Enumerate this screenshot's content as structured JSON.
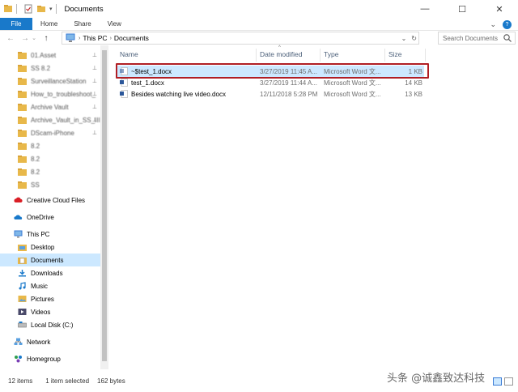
{
  "window": {
    "title": "Documents",
    "minimize": "—",
    "maximize": "☐",
    "close": "✕"
  },
  "ribbon": {
    "tabs": [
      "File",
      "Home",
      "Share",
      "View"
    ],
    "expand": "⌄",
    "help": "?"
  },
  "address": {
    "back": "←",
    "forward": "→",
    "recent": "⌄",
    "up": "↑",
    "segments": [
      "This PC",
      "Documents"
    ],
    "sep": "›",
    "dropdown": "⌄",
    "refresh": "↻",
    "search_placeholder": "Search Documents"
  },
  "nav": {
    "quick_access": [
      {
        "label": "01.Asset",
        "pinned": true
      },
      {
        "label": "SS 8.2",
        "pinned": true
      },
      {
        "label": "SurveillanceStation",
        "pinned": true
      },
      {
        "label": "How_to_troubleshoot_",
        "pinned": true
      },
      {
        "label": "Archive Vault",
        "pinned": true
      },
      {
        "label": "Archive_Vault_in_SS_III",
        "pinned": true
      },
      {
        "label": "DScam-iPhone",
        "pinned": true
      },
      {
        "label": "8.2",
        "pinned": false
      },
      {
        "label": "8.2",
        "pinned": false
      },
      {
        "label": "8.2",
        "pinned": false
      },
      {
        "label": "SS",
        "pinned": false
      }
    ],
    "creative_cloud": "Creative Cloud Files",
    "onedrive": "OneDrive",
    "this_pc": "This PC",
    "pc_items": [
      "Desktop",
      "Documents",
      "Downloads",
      "Music",
      "Pictures",
      "Videos",
      "Local Disk (C:)"
    ],
    "network": "Network",
    "homegroup": "Homegroup",
    "pin_glyph": "📌"
  },
  "columns": {
    "name": "Name",
    "date": "Date modified",
    "type": "Type",
    "size": "Size",
    "sort_glyph": "^"
  },
  "files": [
    {
      "name": "~$test_1.docx",
      "date": "3/27/2019 11:45 A...",
      "type": "Microsoft Word 文...",
      "size": "1 KB",
      "selected": true
    },
    {
      "name": "test_1.docx",
      "date": "3/27/2019 11:44 A...",
      "type": "Microsoft Word 文...",
      "size": "14 KB",
      "selected": false
    },
    {
      "name": "Besides watching live video.docx",
      "date": "12/11/2018 5:28 PM",
      "type": "Microsoft Word 文...",
      "size": "13 KB",
      "selected": false
    }
  ],
  "status": {
    "count": "12 items",
    "selected": "1 item selected",
    "size": "162 bytes"
  },
  "watermark": "头条 @诚鑫致达科技",
  "colors": {
    "accent": "#1979ca",
    "selection": "#cce8ff",
    "highlight_border": "#b01e24",
    "folder": "#e8b84a"
  }
}
